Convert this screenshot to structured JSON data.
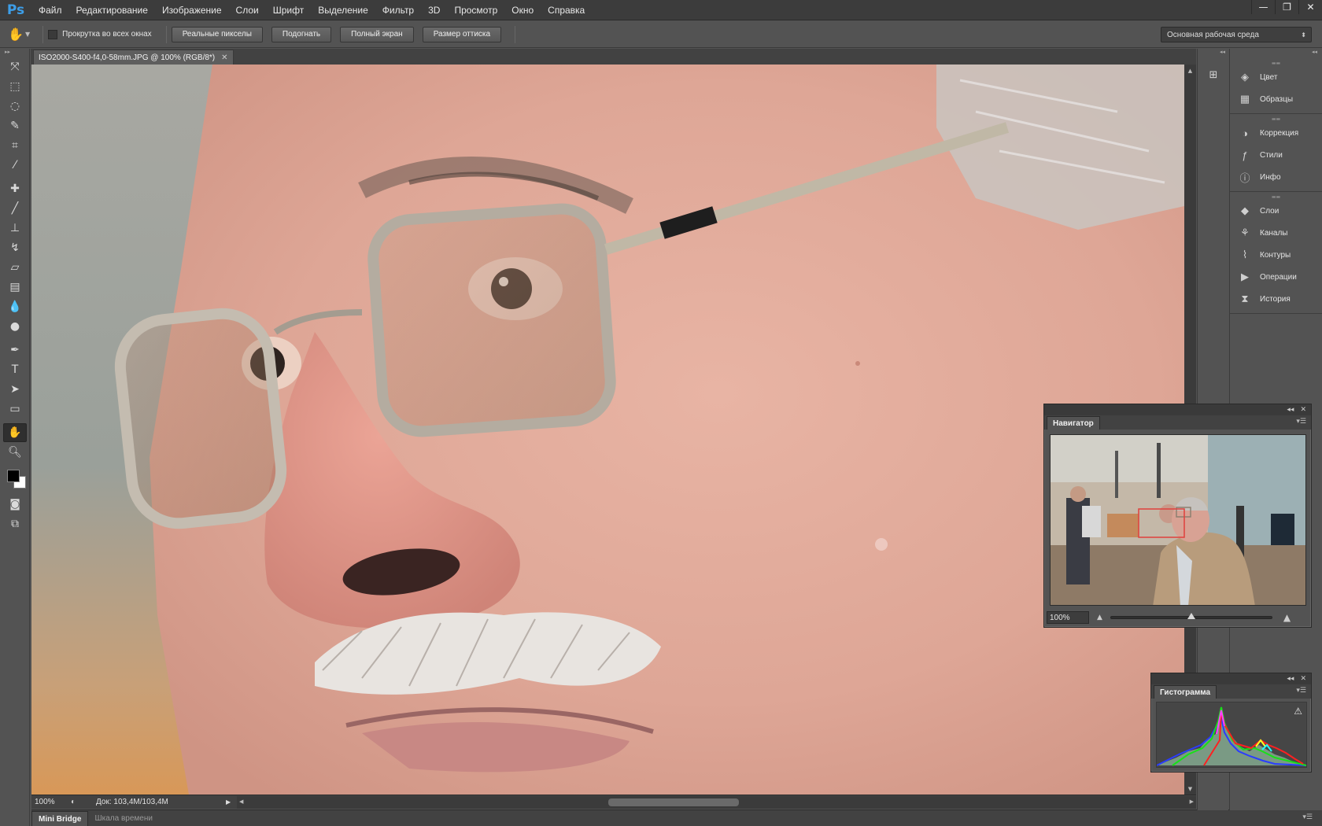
{
  "app": {
    "logo": "Ps"
  },
  "menu": [
    "Файл",
    "Редактирование",
    "Изображение",
    "Слои",
    "Шрифт",
    "Выделение",
    "Фильтр",
    "3D",
    "Просмотр",
    "Окно",
    "Справка"
  ],
  "window_controls": {
    "minimize": "—",
    "restore": "❐",
    "close": "✕"
  },
  "options_bar": {
    "scroll_all_windows": "Прокрутка во всех окнах",
    "buttons": [
      "Реальные пикселы",
      "Подогнать",
      "Полный экран",
      "Размер оттиска"
    ],
    "workspace": "Основная рабочая среда"
  },
  "document": {
    "tab_title": "ISO2000-S400-f4,0-58mm.JPG @ 100% (RGB/8*)",
    "zoom": "100%",
    "doc_info": "Док: 103,4M/103,4M"
  },
  "tools": [
    "move-tool",
    "marquee-tool",
    "lasso-tool",
    "quick-selection-tool",
    "crop-tool",
    "eyedropper-tool",
    "spot-healing-tool",
    "brush-tool",
    "clone-stamp-tool",
    "history-brush-tool",
    "eraser-tool",
    "gradient-tool",
    "blur-tool",
    "dodge-tool",
    "pen-tool",
    "type-tool",
    "path-selection-tool",
    "rectangle-tool",
    "hand-tool",
    "zoom-tool"
  ],
  "swatches": {
    "foreground": "#000000",
    "background": "#ffffff"
  },
  "bottom_tabs": {
    "mini_bridge": "Mini Bridge",
    "timeline": "Шкала времени"
  },
  "panels": {
    "group1": [
      {
        "label": "Цвет",
        "icon": "color-icon"
      },
      {
        "label": "Образцы",
        "icon": "swatches-icon"
      }
    ],
    "group2": [
      {
        "label": "Коррекция",
        "icon": "adjustments-icon"
      },
      {
        "label": "Стили",
        "icon": "styles-icon"
      },
      {
        "label": "Инфо",
        "icon": "info-icon"
      }
    ],
    "group3": [
      {
        "label": "Слои",
        "icon": "layers-icon"
      },
      {
        "label": "Каналы",
        "icon": "channels-icon"
      },
      {
        "label": "Контуры",
        "icon": "paths-icon"
      },
      {
        "label": "Операции",
        "icon": "actions-icon"
      },
      {
        "label": "История",
        "icon": "history-icon"
      }
    ]
  },
  "navigator": {
    "title": "Навигатор",
    "zoom": "100%",
    "slider_position": 0.5
  },
  "histogram": {
    "title": "Гистограмма",
    "warning": "⚠"
  },
  "colors": {
    "accent": "#3d9ee8",
    "nav_view_box": "#e0403c"
  }
}
